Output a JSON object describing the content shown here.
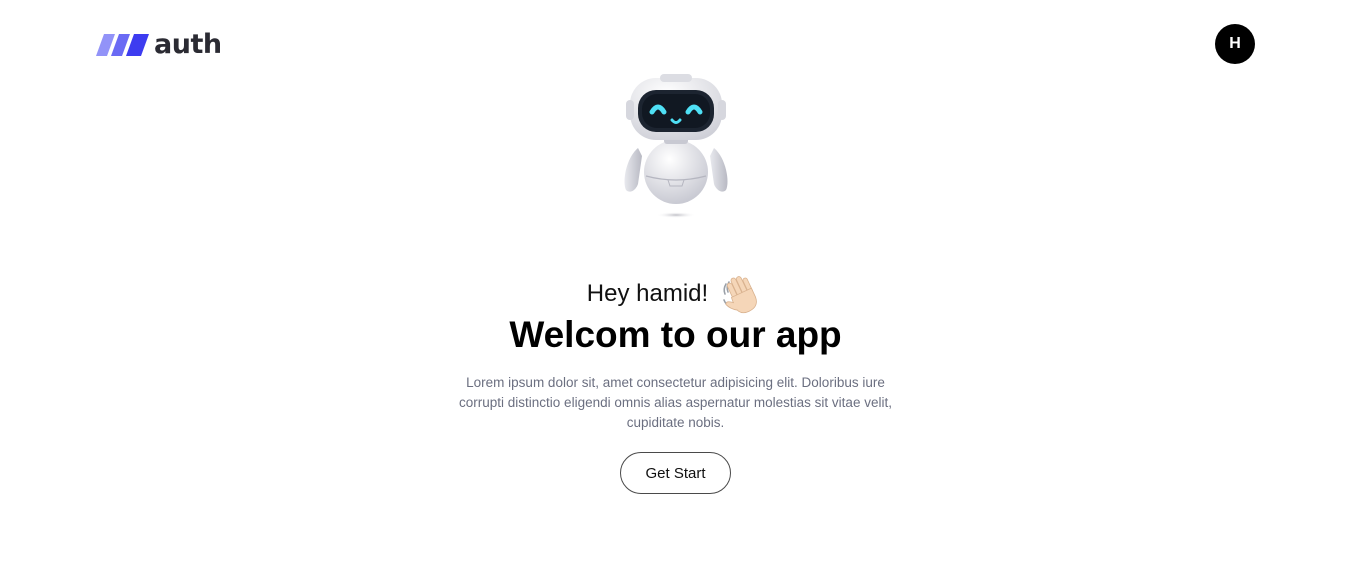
{
  "header": {
    "logo_text": "auth",
    "avatar_initial": "H"
  },
  "hero": {
    "greeting": "Hey hamid!",
    "title": "Welcom to our app",
    "description": "Lorem ipsum dolor sit, amet consectetur adipisicing elit. Doloribus iure corrupti distinctio eligendi omnis alias aspernatur molestias sit vitae velit, cupiditate nobis.",
    "cta_label": "Get Start"
  },
  "icons": {
    "logo": "logo-stripes-icon",
    "robot": "robot-icon",
    "wave": "waving-hand-icon"
  },
  "colors": {
    "logo_stripe_light": "#8b8cf7",
    "logo_stripe_dark": "#3f3ff0",
    "avatar_bg": "#000000",
    "text_primary": "#000000",
    "text_muted": "#6b6f80"
  }
}
